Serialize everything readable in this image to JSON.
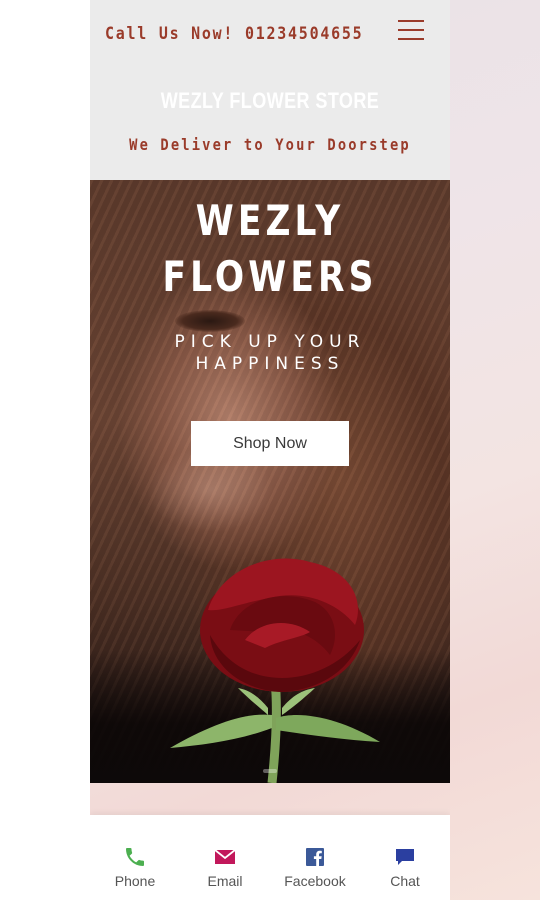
{
  "header": {
    "call_text": "Call Us Now! 01234504655",
    "store_name": "WEZLY FLOWER STORE",
    "tagline": "We Deliver to Your Doorstep",
    "menu_icon": "hamburger-menu-icon"
  },
  "hero": {
    "title_line1": "WEZLY",
    "title_line2": "FLOWERS",
    "subtitle_line1": "PICK UP YOUR",
    "subtitle_line2": "HAPPINESS",
    "button_label": "Shop Now"
  },
  "bottom_bar": {
    "items": [
      {
        "label": "Phone",
        "icon": "phone-icon",
        "color": "#4caf50"
      },
      {
        "label": "Email",
        "icon": "email-icon",
        "color": "#c2185b"
      },
      {
        "label": "Facebook",
        "icon": "facebook-icon",
        "color": "#3b5998"
      },
      {
        "label": "Chat",
        "icon": "chat-icon",
        "color": "#2b3fa0"
      }
    ]
  },
  "colors": {
    "accent": "#9a3b2a",
    "header_bg": "#ebebeb"
  }
}
